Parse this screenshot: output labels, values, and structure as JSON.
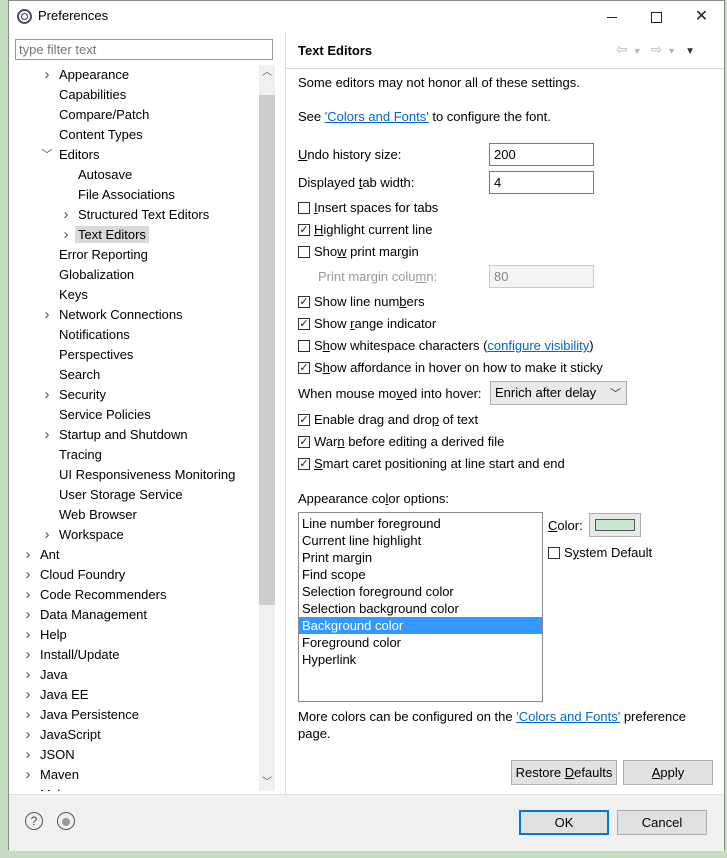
{
  "window": {
    "title": "Preferences"
  },
  "filter": {
    "placeholder": "type filter text"
  },
  "tree": [
    {
      "label": "Appearance",
      "indent": 1,
      "toggle": "collapsed"
    },
    {
      "label": "Capabilities",
      "indent": 1,
      "toggle": "none"
    },
    {
      "label": "Compare/Patch",
      "indent": 1,
      "toggle": "none"
    },
    {
      "label": "Content Types",
      "indent": 1,
      "toggle": "none"
    },
    {
      "label": "Editors",
      "indent": 1,
      "toggle": "expanded"
    },
    {
      "label": "Autosave",
      "indent": 2,
      "toggle": "none"
    },
    {
      "label": "File Associations",
      "indent": 2,
      "toggle": "none"
    },
    {
      "label": "Structured Text Editors",
      "indent": 2,
      "toggle": "collapsed"
    },
    {
      "label": "Text Editors",
      "indent": 2,
      "toggle": "collapsed",
      "selected": true
    },
    {
      "label": "Error Reporting",
      "indent": 1,
      "toggle": "none"
    },
    {
      "label": "Globalization",
      "indent": 1,
      "toggle": "none"
    },
    {
      "label": "Keys",
      "indent": 1,
      "toggle": "none"
    },
    {
      "label": "Network Connections",
      "indent": 1,
      "toggle": "collapsed"
    },
    {
      "label": "Notifications",
      "indent": 1,
      "toggle": "none"
    },
    {
      "label": "Perspectives",
      "indent": 1,
      "toggle": "none"
    },
    {
      "label": "Search",
      "indent": 1,
      "toggle": "none"
    },
    {
      "label": "Security",
      "indent": 1,
      "toggle": "collapsed"
    },
    {
      "label": "Service Policies",
      "indent": 1,
      "toggle": "none"
    },
    {
      "label": "Startup and Shutdown",
      "indent": 1,
      "toggle": "collapsed"
    },
    {
      "label": "Tracing",
      "indent": 1,
      "toggle": "none"
    },
    {
      "label": "UI Responsiveness Monitoring",
      "indent": 1,
      "toggle": "none"
    },
    {
      "label": "User Storage Service",
      "indent": 1,
      "toggle": "none"
    },
    {
      "label": "Web Browser",
      "indent": 1,
      "toggle": "none"
    },
    {
      "label": "Workspace",
      "indent": 1,
      "toggle": "collapsed"
    },
    {
      "label": "Ant",
      "indent": 0,
      "toggle": "collapsed"
    },
    {
      "label": "Cloud Foundry",
      "indent": 0,
      "toggle": "collapsed"
    },
    {
      "label": "Code Recommenders",
      "indent": 0,
      "toggle": "collapsed"
    },
    {
      "label": "Data Management",
      "indent": 0,
      "toggle": "collapsed"
    },
    {
      "label": "Help",
      "indent": 0,
      "toggle": "collapsed"
    },
    {
      "label": "Install/Update",
      "indent": 0,
      "toggle": "collapsed"
    },
    {
      "label": "Java",
      "indent": 0,
      "toggle": "collapsed"
    },
    {
      "label": "Java EE",
      "indent": 0,
      "toggle": "collapsed"
    },
    {
      "label": "Java Persistence",
      "indent": 0,
      "toggle": "collapsed"
    },
    {
      "label": "JavaScript",
      "indent": 0,
      "toggle": "collapsed"
    },
    {
      "label": "JSON",
      "indent": 0,
      "toggle": "collapsed"
    },
    {
      "label": "Maven",
      "indent": 0,
      "toggle": "collapsed"
    },
    {
      "label": "Mylyn",
      "indent": 0,
      "toggle": "collapsed"
    }
  ],
  "page": {
    "title": "Text Editors",
    "note": "Some editors may not honor all of these settings.",
    "see_prefix": "See ",
    "see_link": "'Colors and Fonts'",
    "see_suffix": " to configure the font.",
    "undo_label_u": "U",
    "undo_label_rest": "ndo history size:",
    "undo_value": "200",
    "tab_label_a": "Displayed ",
    "tab_label_u": "t",
    "tab_label_b": "ab width:",
    "tab_value": "4",
    "insert_spaces": {
      "a": "",
      "u": "I",
      "b": "nsert spaces for tabs",
      "checked": false
    },
    "highlight_line": {
      "a": "",
      "u": "H",
      "b": "ighlight current line",
      "checked": true
    },
    "print_margin": {
      "a": "Sho",
      "u": "w",
      "b": " print margin",
      "checked": false
    },
    "print_margin_col_a": "Print margin colu",
    "print_margin_col_u": "m",
    "print_margin_col_b": "n:",
    "print_margin_value": "80",
    "line_numbers": {
      "a": "Show line num",
      "u": "b",
      "b": "ers",
      "checked": true
    },
    "range_indicator": {
      "a": "Show ",
      "u": "r",
      "b": "ange indicator",
      "checked": true
    },
    "whitespace": {
      "a": "S",
      "u": "h",
      "b": "ow whitespace characters (",
      "checked": false
    },
    "whitespace_link": "configure visibility",
    "whitespace_close": ")",
    "affordance": {
      "a": "S",
      "u": "h",
      "b": "ow affordance in hover on how to make it sticky",
      "checked": true
    },
    "hover_label_a": "When mouse mo",
    "hover_label_u": "v",
    "hover_label_b": "ed into hover:",
    "hover_value": "Enrich after delay",
    "drag_drop": {
      "a": "Enable drag and dro",
      "u": "p",
      "b": " of text",
      "checked": true
    },
    "warn_derived": {
      "a": "War",
      "u": "n",
      "b": " before editing a derived file",
      "checked": true
    },
    "smart_caret": {
      "a": "",
      "u": "S",
      "b": "mart caret positioning at line start and end",
      "checked": true
    },
    "appearance_label_a": "Appearance co",
    "appearance_label_u": "l",
    "appearance_label_b": "or options:",
    "color_items": [
      "Line number foreground",
      "Current line highlight",
      "Print margin",
      "Find scope",
      "Selection foreground color",
      "Selection background color",
      "Background color",
      "Foreground color",
      "Hyperlink"
    ],
    "selected_color_index": 6,
    "color_label_u": "C",
    "color_label_rest": "olor:",
    "swatch_color": "#c7e7cf",
    "system_default": {
      "a": "S",
      "u": "y",
      "b": "stem Default",
      "checked": false
    },
    "more_colors_prefix": "More colors can be configured on the ",
    "more_colors_link": "'Colors and Fonts'",
    "more_colors_suffix": " preference",
    "more_colors_line2": "page.",
    "restore_a": "Restore ",
    "restore_u": "D",
    "restore_b": "efaults",
    "apply_u": "A",
    "apply_b": "pply"
  },
  "footer": {
    "ok": "OK",
    "cancel": "Cancel"
  },
  "colors": {
    "selection": "#3399ff",
    "link": "#0066cc",
    "default_button_border": "#0078d7"
  }
}
